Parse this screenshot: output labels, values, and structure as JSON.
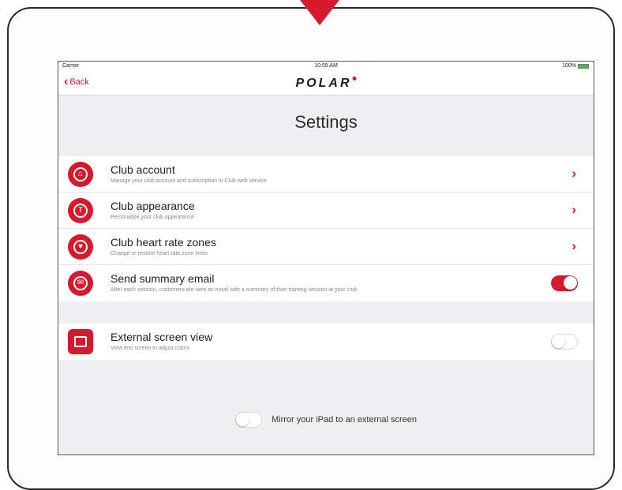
{
  "statusbar": {
    "carrier": "Carrier",
    "time": "10:55 AM",
    "battery": "100%"
  },
  "nav": {
    "back_label": "Back",
    "logo_text": "POLAR"
  },
  "page": {
    "title": "Settings"
  },
  "settings": [
    {
      "title": "Club account",
      "subtitle": "Manage your club account and subscription in Club web service",
      "icon": "club-account-icon",
      "control": "chevron"
    },
    {
      "title": "Club appearance",
      "subtitle": "Personalize your club appearance",
      "icon": "club-appearance-icon",
      "control": "chevron"
    },
    {
      "title": "Club heart rate zones",
      "subtitle": "Change or restore heart rate zone limits",
      "icon": "heart-icon",
      "control": "chevron"
    },
    {
      "title": "Send summary email",
      "subtitle": "After each session, customers are sent an email with a summary of their training session at your club",
      "icon": "email-icon",
      "control": "toggle",
      "enabled": true
    }
  ],
  "external": {
    "title": "External screen view",
    "subtitle": "View test screen to adjust colors",
    "icon": "screen-icon",
    "enabled": false
  },
  "mirror": {
    "label": "Mirror your iPad to an external screen",
    "enabled": false
  },
  "colors": {
    "accent": "#d7192d"
  }
}
